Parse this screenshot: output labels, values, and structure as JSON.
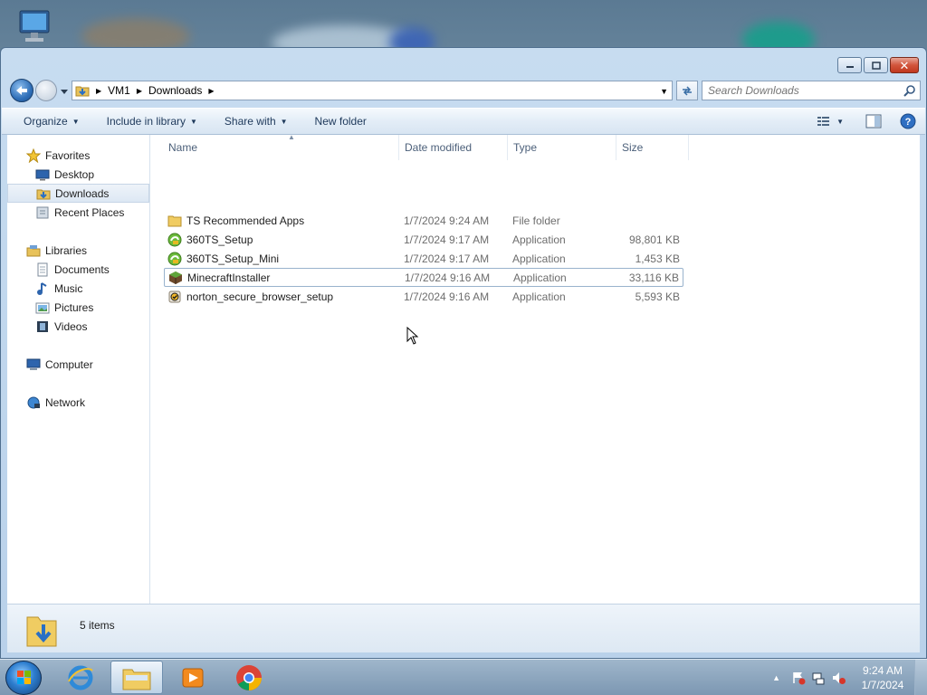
{
  "window": {
    "minimize_label": "–",
    "maximize_label": "□",
    "close_label": "✕"
  },
  "address": {
    "root_label": "VM1",
    "current_label": "Downloads"
  },
  "search": {
    "placeholder": "Search Downloads"
  },
  "toolbar": {
    "organize": "Organize",
    "include_in_library": "Include in library",
    "share_with": "Share with",
    "new_folder": "New folder"
  },
  "nav": {
    "favorites": "Favorites",
    "desktop": "Desktop",
    "downloads": "Downloads",
    "recent_places": "Recent Places",
    "libraries": "Libraries",
    "documents": "Documents",
    "music": "Music",
    "pictures": "Pictures",
    "videos": "Videos",
    "computer": "Computer",
    "network": "Network"
  },
  "columns": {
    "name": "Name",
    "date": "Date modified",
    "type": "Type",
    "size": "Size"
  },
  "files": [
    {
      "name": "TS Recommended Apps",
      "date": "1/7/2024 9:24 AM",
      "type": "File folder",
      "size": "",
      "icon": "folder-icon"
    },
    {
      "name": "360TS_Setup",
      "date": "1/7/2024 9:17 AM",
      "type": "Application",
      "size": "98,801 KB",
      "icon": "360-installer-icon"
    },
    {
      "name": "360TS_Setup_Mini",
      "date": "1/7/2024 9:17 AM",
      "type": "Application",
      "size": "1,453 KB",
      "icon": "360-installer-icon"
    },
    {
      "name": "MinecraftInstaller",
      "date": "1/7/2024 9:16 AM",
      "type": "Application",
      "size": "33,116 KB",
      "icon": "minecraft-icon"
    },
    {
      "name": "norton_secure_browser_setup",
      "date": "1/7/2024 9:16 AM",
      "type": "Application",
      "size": "5,593 KB",
      "icon": "norton-icon"
    }
  ],
  "details": {
    "item_count": "5 items"
  },
  "taskbar": {
    "time": "9:24 AM",
    "date": "1/7/2024"
  }
}
